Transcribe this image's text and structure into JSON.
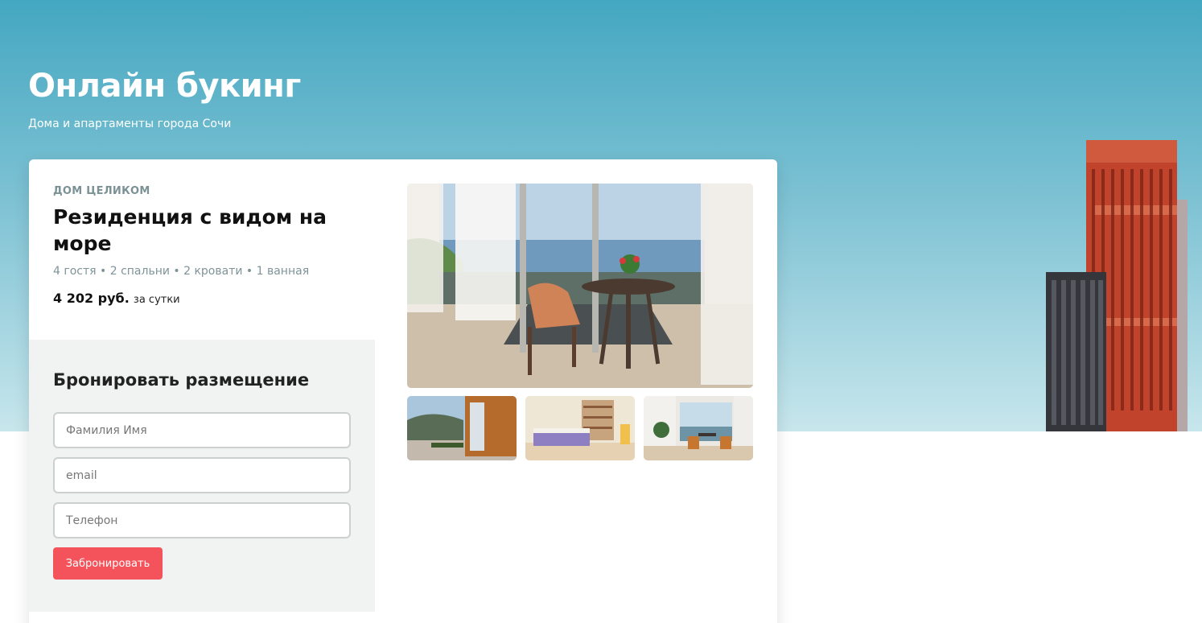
{
  "hero": {
    "title": "Онлайн букинг",
    "subtitle": "Дома и апартаменты города Сочи"
  },
  "listing": {
    "type": "ДОМ ЦЕЛИКОМ",
    "title": "Резиденция с видом на море",
    "meta": "4 гостя • 2 спальни • 2 кровати • 1 ванная",
    "price": "4 202 руб.",
    "price_unit": "за сутки"
  },
  "booking": {
    "title": "Бронировать размещение",
    "name_placeholder": "Фамилия Имя",
    "email_placeholder": "email",
    "phone_placeholder": "Телефон",
    "submit_label": "Забронировать"
  },
  "colors": {
    "accent": "#f4535b",
    "sky_top": "#44a7c1",
    "sky_bottom": "#c7e6ec"
  }
}
